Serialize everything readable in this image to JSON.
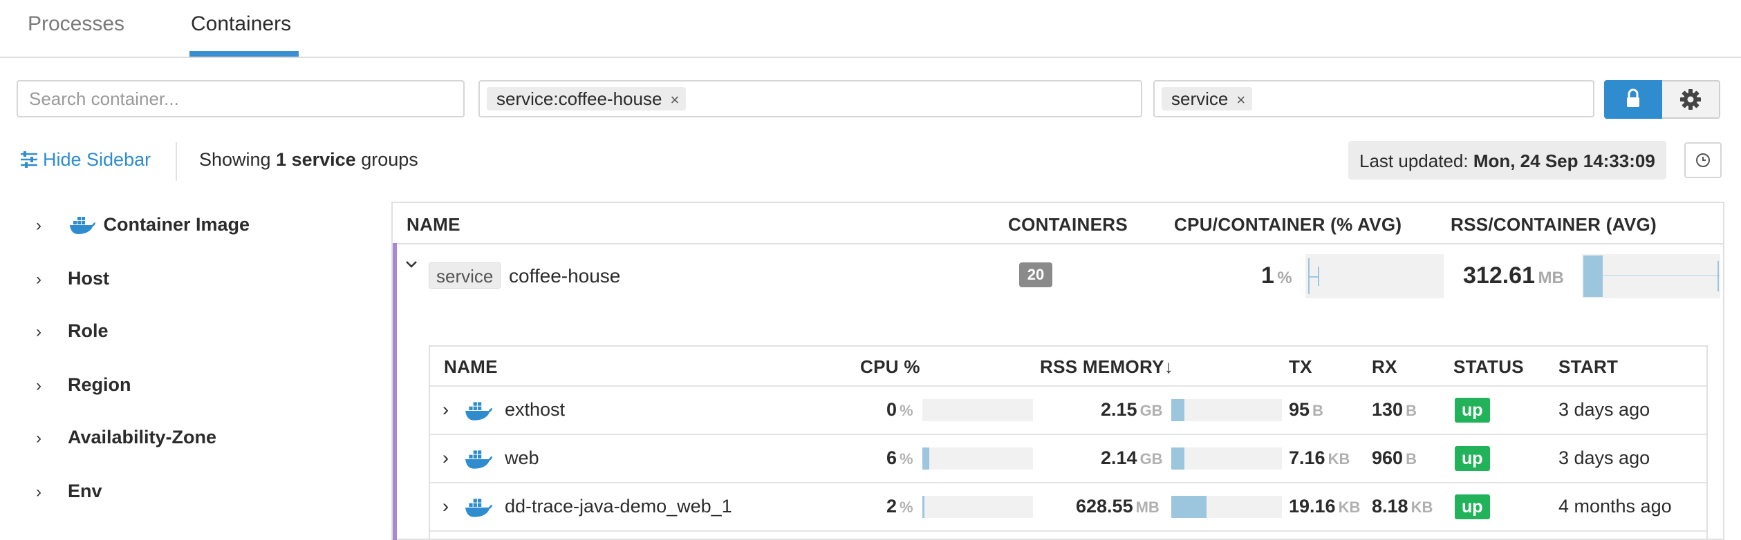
{
  "tabs": [
    {
      "label": "Processes",
      "active": false
    },
    {
      "label": "Containers",
      "active": true
    }
  ],
  "filters": {
    "search_placeholder": "Search container...",
    "filter_chip": "service:coffee-house",
    "group_chip": "service",
    "remove_glyph": "×"
  },
  "info": {
    "hide_sidebar": "Hide Sidebar",
    "showing_prefix": "Showing ",
    "showing_bold": "1 service",
    "showing_suffix": " groups",
    "last_updated_label": "Last updated: ",
    "last_updated_value": "Mon, 24 Sep 14:33:09"
  },
  "sidebar": {
    "items": [
      {
        "label": "Container Image",
        "icon": "docker-icon"
      },
      {
        "label": "Host"
      },
      {
        "label": "Role"
      },
      {
        "label": "Region"
      },
      {
        "label": "Availability-Zone"
      },
      {
        "label": "Env"
      }
    ]
  },
  "group_table": {
    "headers": [
      "NAME",
      "CONTAINERS",
      "CPU/CONTAINER (% AVG)",
      "RSS/CONTAINER (AVG)"
    ],
    "group": {
      "tag_key": "service",
      "tag_value": "coffee-house",
      "containers": "20",
      "cpu_value": "1",
      "cpu_unit": "%",
      "rss_value": "312.61",
      "rss_unit": "MB"
    }
  },
  "container_table": {
    "headers": [
      "NAME",
      "CPU %",
      "RSS MEMORY↓",
      "TX",
      "RX",
      "STATUS",
      "START"
    ],
    "rows": [
      {
        "name": "exthost",
        "cpu": "0",
        "cpu_unit": "%",
        "cpu_level": 0.0,
        "rss": "2.15",
        "rss_unit": "GB",
        "rss_level": 0.12,
        "tx": "95",
        "tx_unit": "B",
        "rx": "130",
        "rx_unit": "B",
        "status": "up",
        "start": "3 days ago"
      },
      {
        "name": "web",
        "cpu": "6",
        "cpu_unit": "%",
        "cpu_level": 0.06,
        "rss": "2.14",
        "rss_unit": "GB",
        "rss_level": 0.12,
        "tx": "7.16",
        "tx_unit": "KB",
        "rx": "960",
        "rx_unit": "B",
        "status": "up",
        "start": "3 days ago"
      },
      {
        "name": "dd-trace-java-demo_web_1",
        "cpu": "2",
        "cpu_unit": "%",
        "cpu_level": 0.02,
        "rss": "628.55",
        "rss_unit": "MB",
        "rss_level": 0.32,
        "tx": "19.16",
        "tx_unit": "KB",
        "rx": "8.18",
        "rx_unit": "KB",
        "status": "up",
        "start": "4 months ago"
      }
    ]
  },
  "colors": {
    "accent": "#2e8ccf",
    "group_bar": "#a987d2",
    "status_up": "#22b35a",
    "bar_fill": "#9cc6de"
  }
}
